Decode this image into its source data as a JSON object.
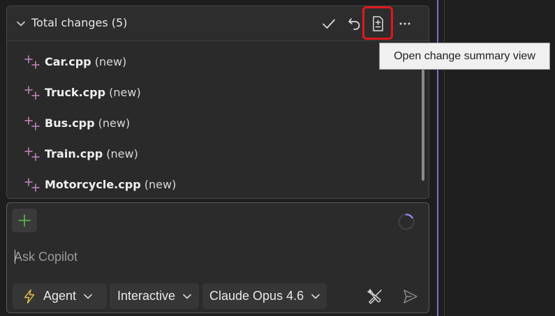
{
  "changes": {
    "title": "Total changes (5)",
    "files": [
      {
        "name": "Car.cpp",
        "tag": "(new)"
      },
      {
        "name": "Truck.cpp",
        "tag": "(new)"
      },
      {
        "name": "Bus.cpp",
        "tag": "(new)"
      },
      {
        "name": "Train.cpp",
        "tag": "(new)"
      },
      {
        "name": "Motorcycle.cpp",
        "tag": "(new)"
      }
    ],
    "icons": {
      "collapse": "chevron-down-icon",
      "accept": "checkmark-icon",
      "undo": "undo-icon",
      "summary": "diff-file-icon",
      "more": "ellipsis-icon",
      "file_added": "sparkle-plus-icon"
    }
  },
  "tooltip": {
    "text": "Open change summary view"
  },
  "chat": {
    "placeholder": "Ask Copilot",
    "mode_label": "Agent",
    "style_label": "Interactive",
    "model_label": "Claude Opus 4.6",
    "icons": {
      "attach": "plus-icon",
      "loading": "spinner-icon",
      "mode": "lightning-bolt-icon",
      "tools": "wrench-screwdriver-icon",
      "send": "send-icon"
    }
  },
  "colors": {
    "highlight_box": "#e0181c",
    "splitter": "#7a6fd6",
    "added_icon": "#c586c0",
    "attach_plus": "#5fbf4f",
    "bolt": "#e8c34a"
  }
}
